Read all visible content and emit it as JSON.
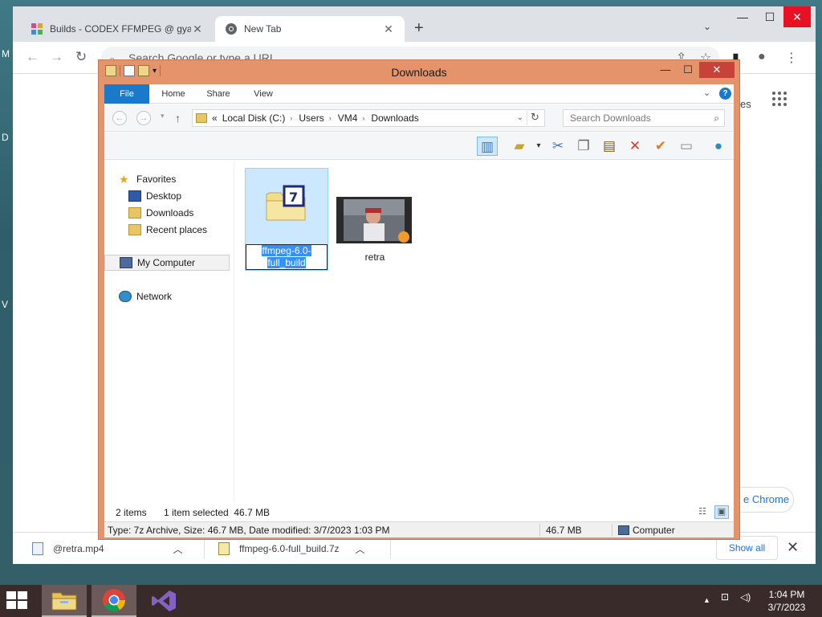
{
  "desktop": {
    "left_letters": [
      "M",
      "D",
      "V"
    ]
  },
  "browser": {
    "tabs": [
      {
        "label": "Builds - CODEX FFMPEG @ gyan.dev",
        "active": false
      },
      {
        "label": "New Tab",
        "active": true
      }
    ],
    "new_tab_symbol": "+",
    "omnibox_placeholder": "Search Google or type a URL",
    "ntp_partial_text": "es",
    "customize_label": "e Chrome",
    "download_shelf": {
      "items": [
        {
          "filename": "@retra.mp4",
          "icon": "video-file-icon"
        },
        {
          "filename": "ffmpeg-6.0-full_build.7z",
          "icon": "archive-file-icon"
        }
      ],
      "show_all_label": "Show all"
    }
  },
  "explorer": {
    "title": "Downloads",
    "ribbon_tabs": [
      {
        "label": "File"
      },
      {
        "label": "Home"
      },
      {
        "label": "Share"
      },
      {
        "label": "View"
      }
    ],
    "address": {
      "prefix": "«",
      "crumbs": [
        "Local Disk (C:)",
        "Users",
        "VM4",
        "Downloads"
      ]
    },
    "search_placeholder": "Search Downloads",
    "nav_pane": {
      "favorites_label": "Favorites",
      "favorites": [
        "Desktop",
        "Downloads",
        "Recent places"
      ],
      "computer_label": "My Computer",
      "network_label": "Network"
    },
    "items": [
      {
        "name": "ffmpeg-6.0-full_build",
        "type": "7z-archive",
        "selected": true,
        "renaming": true
      },
      {
        "name": "retra",
        "type": "video",
        "selected": false
      }
    ],
    "status": {
      "item_count": "2 items",
      "selection": "1 item selected  46.7 MB"
    },
    "details_bar": {
      "info": "Type: 7z Archive, Size: 46.7 MB, Date modified: 3/7/2023 1:03 PM",
      "size": "46.7 MB",
      "location": "Computer"
    }
  },
  "taskbar": {
    "apps": [
      "file-explorer",
      "chrome",
      "visual-studio"
    ],
    "clock_time": "1:04 PM",
    "clock_date": "3/7/2023"
  },
  "colors": {
    "explorer_frame": "#e4936a",
    "ribbon_file_tab": "#1979ca",
    "selection": "#cce8ff",
    "rename_highlight": "#3390ff",
    "taskbar": "#3a2b2b"
  }
}
